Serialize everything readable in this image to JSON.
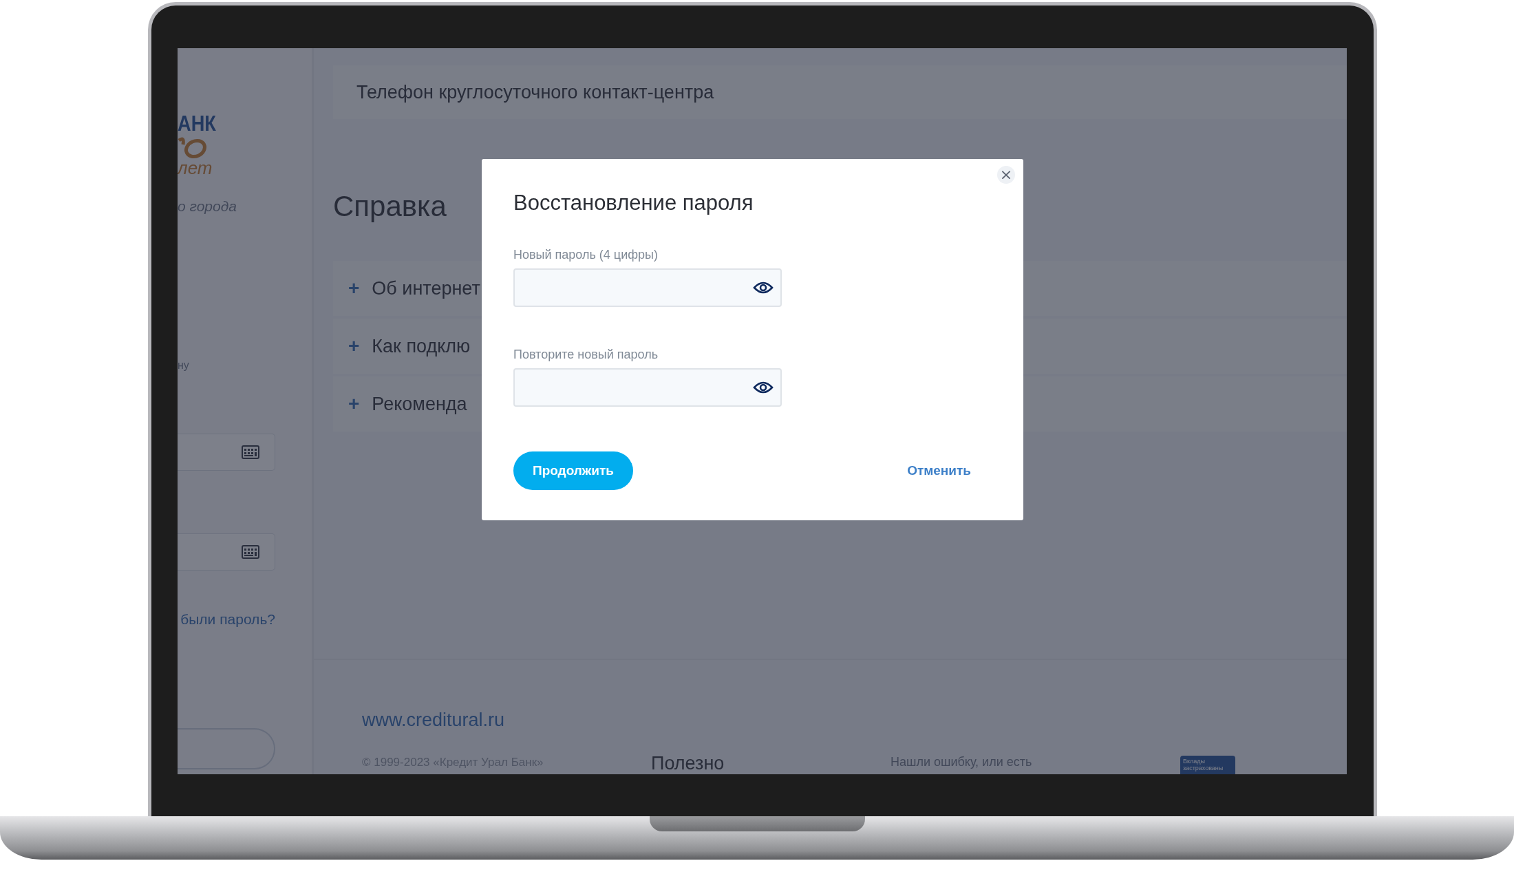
{
  "sidebar": {
    "logo": {
      "top_text": "АНК",
      "bottom_text": "лет"
    },
    "city_text": "о города",
    "text_fragment": "ну",
    "forgot_link": "были пароль?"
  },
  "header": {
    "phone_label": "Телефон круглосуточного контакт-центра"
  },
  "help": {
    "title": "Справка",
    "items": [
      {
        "icon": "+",
        "label": "Об интернет"
      },
      {
        "icon": "+",
        "label": "Как подклю"
      },
      {
        "icon": "+",
        "label": "Рекоменда"
      }
    ]
  },
  "footer": {
    "site_link": "www.creditural.ru",
    "copyright": "© 1999-2023 «Кредит Урал Банк»",
    "useful_heading": "Полезно",
    "feedback_text": "Нашли ошибку, или есть",
    "badge": "Вклады застрахованы"
  },
  "modal": {
    "title": "Восстановление пароля",
    "close": "×",
    "fields": [
      {
        "label": "Новый пароль (4 цифры)"
      },
      {
        "label": "Повторите новый пароль"
      }
    ],
    "primary_button": "Продолжить",
    "cancel_link": "Отменить"
  }
}
